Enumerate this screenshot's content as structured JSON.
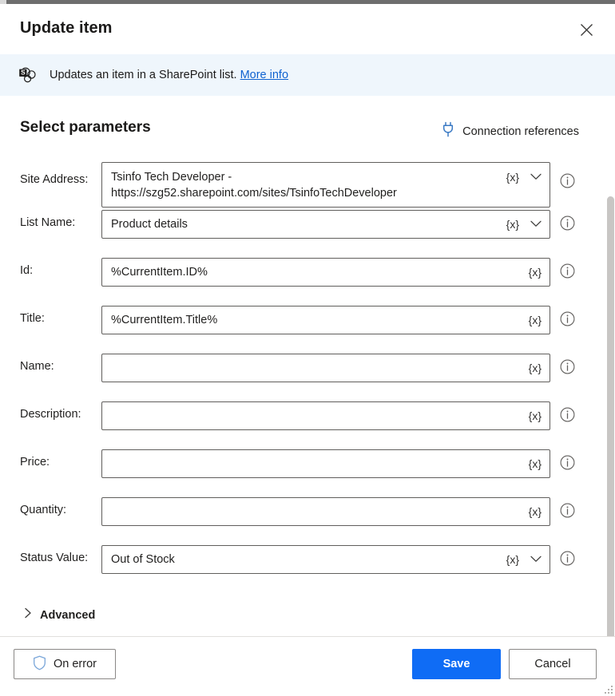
{
  "dialog": {
    "title": "Update item",
    "close_icon": "close-icon"
  },
  "banner": {
    "icon": "sharepoint-icon",
    "text": "Updates an item in a SharePoint list.",
    "link_label": "More info"
  },
  "parameters_section": {
    "heading": "Select parameters",
    "connection_references": {
      "icon": "plug-icon",
      "label": "Connection references"
    }
  },
  "fields": [
    {
      "label": "Site Address:",
      "value": "Tsinfo Tech Developer - https://szg52.sharepoint.com/sites/TsinfoTechDeveloper",
      "fx": "{x}",
      "has_dropdown": true,
      "info_icon": "info-icon",
      "multiline": true
    },
    {
      "label": "List Name:",
      "value": "Product details",
      "fx": "{x}",
      "has_dropdown": true,
      "info_icon": "info-icon",
      "multiline": false
    },
    {
      "label": "Id:",
      "value": "%CurrentItem.ID%",
      "fx": "{x}",
      "has_dropdown": false,
      "info_icon": "info-icon",
      "multiline": false
    },
    {
      "label": "Title:",
      "value": "%CurrentItem.Title%",
      "fx": "{x}",
      "has_dropdown": false,
      "info_icon": "info-icon",
      "multiline": false
    },
    {
      "label": "Name:",
      "value": "",
      "fx": "{x}",
      "has_dropdown": false,
      "info_icon": "info-icon",
      "multiline": false
    },
    {
      "label": "Description:",
      "value": "",
      "fx": "{x}",
      "has_dropdown": false,
      "info_icon": "info-icon",
      "multiline": false
    },
    {
      "label": "Price:",
      "value": "",
      "fx": "{x}",
      "has_dropdown": false,
      "info_icon": "info-icon",
      "multiline": false
    },
    {
      "label": "Quantity:",
      "value": "",
      "fx": "{x}",
      "has_dropdown": false,
      "info_icon": "info-icon",
      "multiline": false
    },
    {
      "label": "Status Value:",
      "value": "Out of Stock",
      "fx": "{x}",
      "has_dropdown": true,
      "info_icon": "info-icon",
      "multiline": false
    }
  ],
  "advanced": {
    "label": "Advanced",
    "chevron_icon": "chevron-right-icon",
    "expanded": false
  },
  "footer": {
    "on_error_label": "On error",
    "on_error_icon": "shield-icon",
    "save_label": "Save",
    "cancel_label": "Cancel"
  },
  "colors": {
    "accent": "#0f6cf5",
    "banner_bg": "#eff6fc",
    "link": "#0f62d0",
    "border": "#605e5c",
    "shield": "#7aa6d9",
    "text": "#201f1e"
  }
}
